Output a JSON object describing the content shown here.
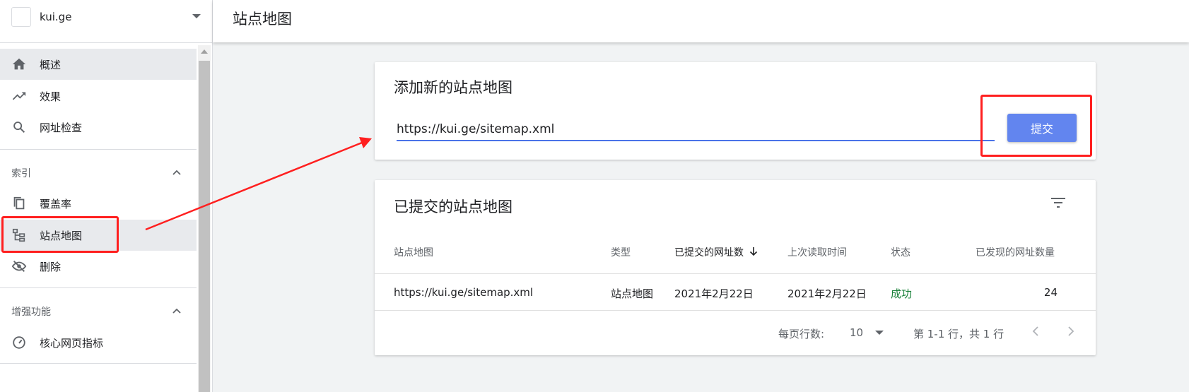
{
  "sidebar": {
    "property": "kui.ge",
    "items": [
      {
        "label": "概述",
        "icon": "home-icon"
      },
      {
        "label": "效果",
        "icon": "trending-up-icon"
      },
      {
        "label": "网址检查",
        "icon": "search-icon"
      }
    ],
    "section_index": {
      "label": "索引",
      "items": [
        {
          "label": "覆盖率",
          "icon": "copy-icon"
        },
        {
          "label": "站点地图",
          "icon": "sitemap-icon"
        },
        {
          "label": "删除",
          "icon": "eye-off-icon"
        }
      ]
    },
    "section_enhance": {
      "label": "增强功能",
      "items": [
        {
          "label": "核心网页指标",
          "icon": "speed-gauge-icon"
        }
      ]
    }
  },
  "header": {
    "title": "站点地图"
  },
  "add_card": {
    "title": "添加新的站点地图",
    "input_value": "https://kui.ge/sitemap.xml",
    "submit_label": "提交"
  },
  "list_card": {
    "title": "已提交的站点地图",
    "columns": [
      "站点地图",
      "类型",
      "已提交的网址数",
      "上次读取时间",
      "状态",
      "已发现的网址数量"
    ],
    "rows": [
      {
        "sitemap": "https://kui.ge/sitemap.xml",
        "type": "站点地图",
        "submitted": "2021年2月22日",
        "last_read": "2021年2月22日",
        "status": "成功",
        "discovered": "24"
      }
    ],
    "footer": {
      "rows_per_page_label": "每页行数:",
      "rows_per_page": "10",
      "range": "第 1-1 行，共 1 行"
    }
  },
  "colors": {
    "accent": "#6285ef",
    "success": "#188038",
    "annotation": "#ff1f1f"
  }
}
